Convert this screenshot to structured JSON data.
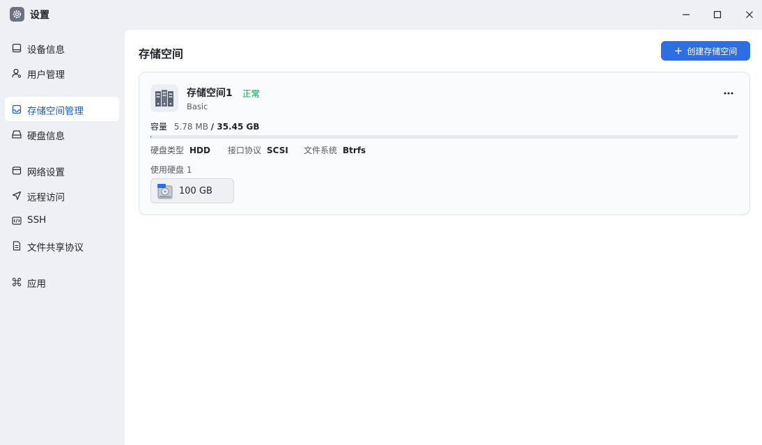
{
  "window": {
    "title": "设置",
    "app_icon": "gear-icon",
    "controls": [
      "minimize-icon",
      "maximize-icon",
      "close-icon"
    ]
  },
  "sidebar": {
    "items": [
      {
        "label": "设备信息",
        "icon": "monitor-icon"
      },
      {
        "label": "用户管理",
        "icon": "user-icon"
      },
      {
        "label": "存储空间管理",
        "icon": "storage-icon",
        "active": true
      },
      {
        "label": "硬盘信息",
        "icon": "drive-icon"
      },
      {
        "label": "网络设置",
        "icon": "network-icon"
      },
      {
        "label": "远程访问",
        "icon": "send-icon"
      },
      {
        "label": "SSH",
        "icon": "code-icon"
      },
      {
        "label": "文件共享协议",
        "icon": "document-icon"
      },
      {
        "label": "应用",
        "icon": "command-icon"
      }
    ]
  },
  "main": {
    "title": "存储空间",
    "create_button": "创建存储空间",
    "pool": {
      "name": "存储空间1",
      "status": "正常",
      "type": "Basic",
      "capacity_label": "容量",
      "used": "5.78 MB",
      "total": "/ 35.45 GB",
      "usage_fraction": 0.0002,
      "disk_type_label": "硬盘类型",
      "disk_type": "HDD",
      "interface_label": "接口协议",
      "interface": "SCSI",
      "filesystem_label": "文件系统",
      "filesystem": "Btrfs",
      "disks_label": "使用硬盘 1",
      "disk_chip": "100 GB"
    }
  },
  "colors": {
    "accent": "#2d6fe0",
    "status_ok": "#18a34a",
    "active_nav_text": "#1e5cb3"
  }
}
